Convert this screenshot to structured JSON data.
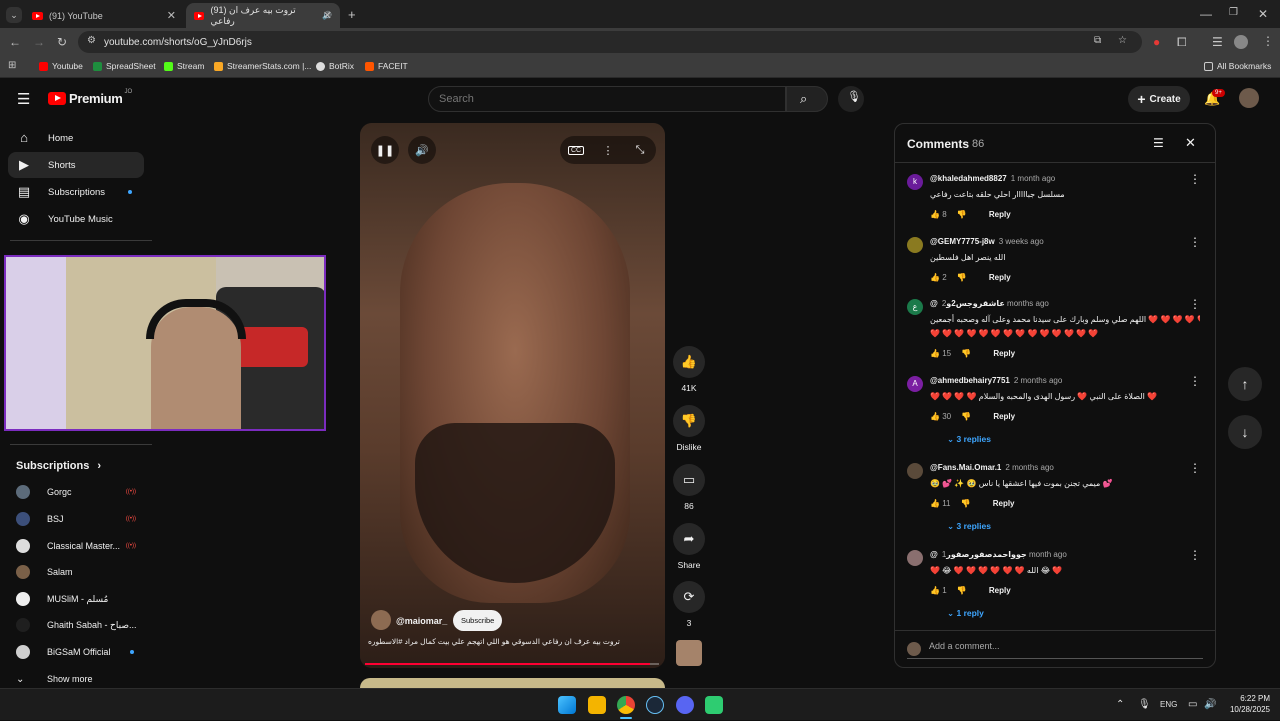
{
  "browser": {
    "tabs": [
      {
        "title": "(91) YouTube"
      },
      {
        "title": "(91) تروت بيه عرف ان رفاعي"
      }
    ],
    "url": "youtube.com/shorts/oG_yJnD6rjs",
    "bookmarks": [
      "Youtube",
      "SpreadSheet",
      "Stream",
      "StreamerStats.com |...",
      "BotRix",
      "FACEIT"
    ],
    "all_bookmarks": "All Bookmarks"
  },
  "yt": {
    "logo": "Premium",
    "region": "JO",
    "search_placeholder": "Search",
    "create_label": "Create",
    "notif_count": "9+"
  },
  "sidebar": {
    "nav": [
      {
        "label": "Home",
        "icon": "home-icon"
      },
      {
        "label": "Shorts",
        "icon": "shorts-icon"
      },
      {
        "label": "Subscriptions",
        "icon": "subscriptions-icon"
      },
      {
        "label": "YouTube Music",
        "icon": "youtube-music-icon"
      }
    ],
    "subs_header": "Subscriptions",
    "subs": [
      {
        "name": "Gorgc",
        "live": true
      },
      {
        "name": "BSJ",
        "live": true
      },
      {
        "name": "Classical Master...",
        "live": true
      },
      {
        "name": "Salam",
        "live": false
      },
      {
        "name": "MUSliM - مُسلم",
        "live": false
      },
      {
        "name": "Ghaith Sabah - صباح...",
        "live": false
      },
      {
        "name": "BiGSaM Official",
        "live": false
      }
    ],
    "show_more": "Show more"
  },
  "short": {
    "channel": "@maiomar_",
    "subscribe": "Subscribe",
    "caption": "تروت بيه عرف ان رفاعي الدسوقي هو اللي اتهجم علي بيت كمال مراد #الاسطوره",
    "likes": "41K",
    "dislike": "Dislike",
    "comments_count": "86",
    "share": "Share",
    "remix_count": "3",
    "progress": 0.97
  },
  "comments": {
    "title": "Comments",
    "count": "86",
    "reply_label": "Reply",
    "add_placeholder": "Add a comment...",
    "items": [
      {
        "avatar": "k",
        "color": "#6a1b9a",
        "handle": "@khaledahmed8827",
        "time": "1 month ago",
        "text": "مسلسل جبااااار احلي حلقه بتاعت رفاعي",
        "likes": "8",
        "replies": ""
      },
      {
        "avatar": "",
        "color": "#8a7a20",
        "handle": "@GEMY7775-j8w",
        "time": "3 weeks ago",
        "text": "الله ينصر اهل فلسطين",
        "likes": "2",
        "replies": ""
      },
      {
        "avatar": "ع",
        "color": "#1b7a4a",
        "handle": "@عاشقروجس2و",
        "time": "2 months ago",
        "text": "اللهم صلي وسلم وبارك على سيدنا محمد وعلى آله وصحبه أجمعين ❤️ ❤️ ❤️ ❤️ ❤️ ❤️",
        "text2": "❤️ ❤️ ❤️ ❤️ ❤️ ❤️ ❤️ ❤️ ❤️ ❤️ ❤️ ❤️ ❤️ ❤️",
        "likes": "15",
        "replies": ""
      },
      {
        "avatar": "A",
        "color": "#7b1fa2",
        "handle": "@ahmedbehairy7751",
        "time": "2 months ago",
        "text": "❤️ ❤️ ❤️ ❤️ الصلاة على النبي ❤️ رسول الهدى والمحبه والسلام ❤️",
        "likes": "30",
        "replies": "3 replies"
      },
      {
        "avatar": "",
        "color": "#5a4a3a",
        "handle": "@Fans.Mai.Omar.1",
        "time": "2 months ago",
        "text": "🥹 💕 ✨ 🥹 ميمي تجنن بموت فيها اعشقها يا ناس 💕",
        "likes": "11",
        "replies": "3 replies"
      },
      {
        "avatar": "",
        "color": "#8a6f6f",
        "handle": "@جوواحمدصفورصفور",
        "time": "1 month ago",
        "text": "❤️ 😂 ❤️ ❤️ ❤️ ❤️ ❤️ ❤️ الله 😂 ❤️",
        "likes": "1",
        "replies": "1 reply"
      }
    ]
  },
  "taskbar": {
    "lang": "ENG",
    "time": "6:22 PM",
    "date": "10/28/2025"
  }
}
